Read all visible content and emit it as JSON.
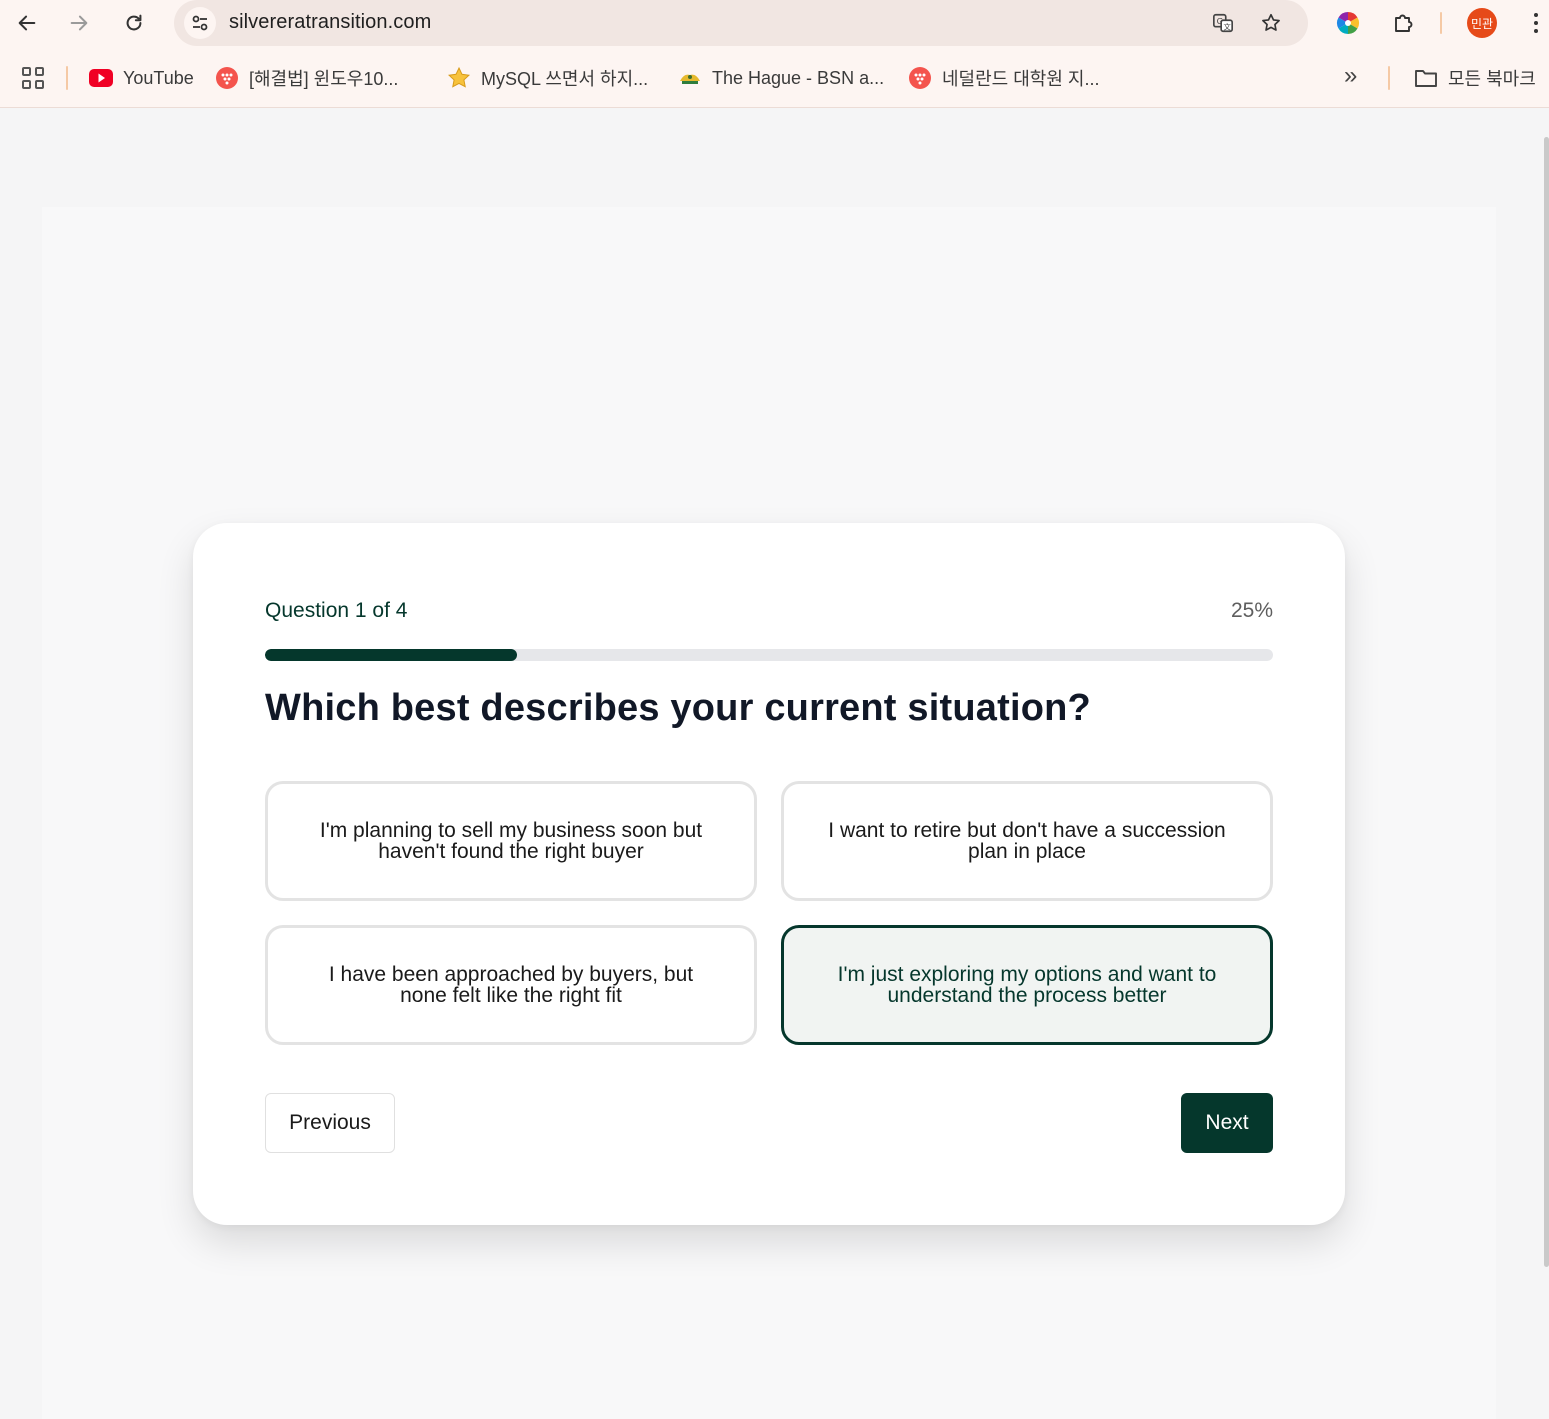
{
  "browser": {
    "url": "silvereratransition.com",
    "profile_initials": "민관",
    "bookmarks": [
      {
        "label": "YouTube",
        "icon": "youtube-icon"
      },
      {
        "label": "[해결법] 윈도우10...",
        "icon": "red-dots-icon"
      },
      {
        "label": "MySQL 쓰면서 하지...",
        "icon": "star-icon"
      },
      {
        "label": "The Hague - BSN a...",
        "icon": "crest-icon"
      },
      {
        "label": "네덜란드 대학원 지...",
        "icon": "red-dots-icon"
      }
    ],
    "all_bookmarks_label": "모든 북마크"
  },
  "quiz": {
    "question_counter": "Question 1 of 4",
    "progress_label": "25%",
    "progress_fraction": 0.25,
    "question": "Which best describes your current situation?",
    "options": [
      {
        "label": "I'm planning to sell my business soon but haven't found the right buyer",
        "selected": false
      },
      {
        "label": "I want to retire but don't have a succession plan in place",
        "selected": false
      },
      {
        "label": "I have been approached by buyers, but none felt like the right fit",
        "selected": false
      },
      {
        "label": "I'm just exploring my options and want to understand the process better",
        "selected": true
      }
    ],
    "previous_label": "Previous",
    "next_label": "Next"
  },
  "colors": {
    "accent": "#05372c",
    "progress_track": "#e6e7ea",
    "selected_bg": "#f1f4f2",
    "browser_bg": "#fdf5f2"
  }
}
